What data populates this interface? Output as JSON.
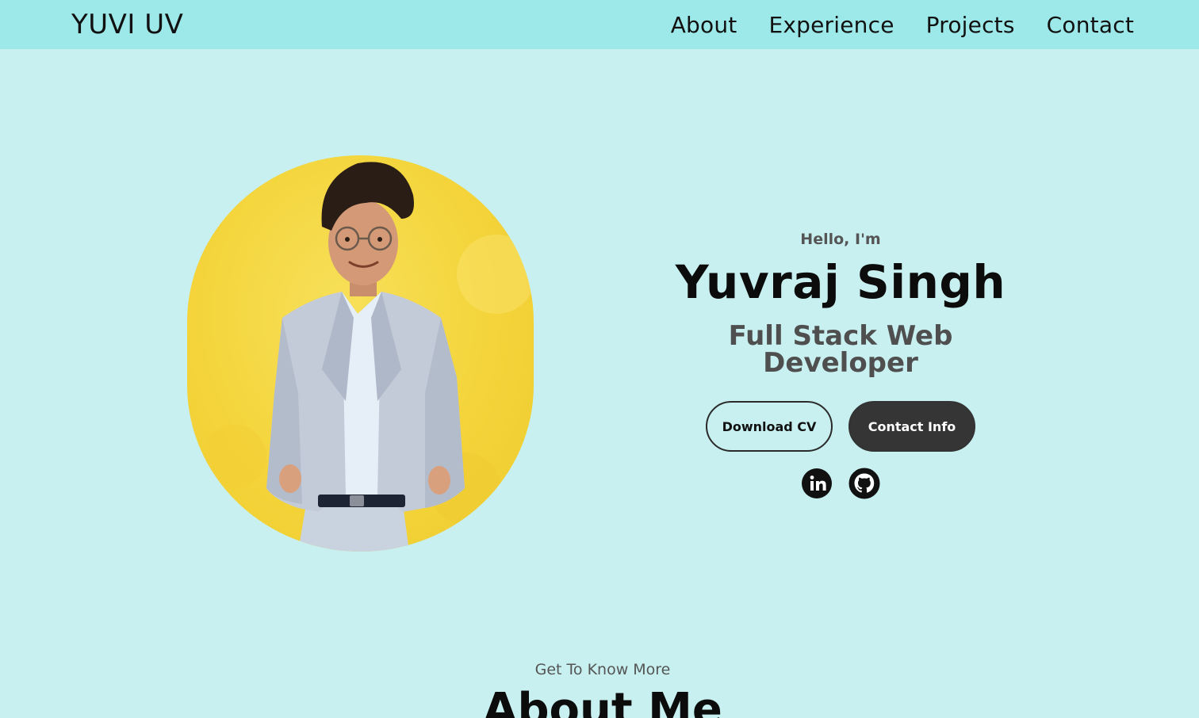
{
  "nav": {
    "logo": "YUVI UV",
    "links": [
      "About",
      "Experience",
      "Projects",
      "Contact"
    ]
  },
  "hero": {
    "greeting": "Hello, I'm",
    "name": "Yuvraj Singh",
    "role": "Full Stack Web Developer",
    "buttons": {
      "download_cv": "Download CV",
      "contact_info": "Contact Info"
    },
    "socials": [
      "linkedin-icon",
      "github-icon"
    ]
  },
  "about": {
    "subtitle": "Get To Know More",
    "title": "About Me"
  },
  "colors": {
    "page_bg": "#c8f0f0",
    "nav_bg": "#9de9e9",
    "photo_bg": "#f4d43a",
    "dark_button": "#353535"
  }
}
